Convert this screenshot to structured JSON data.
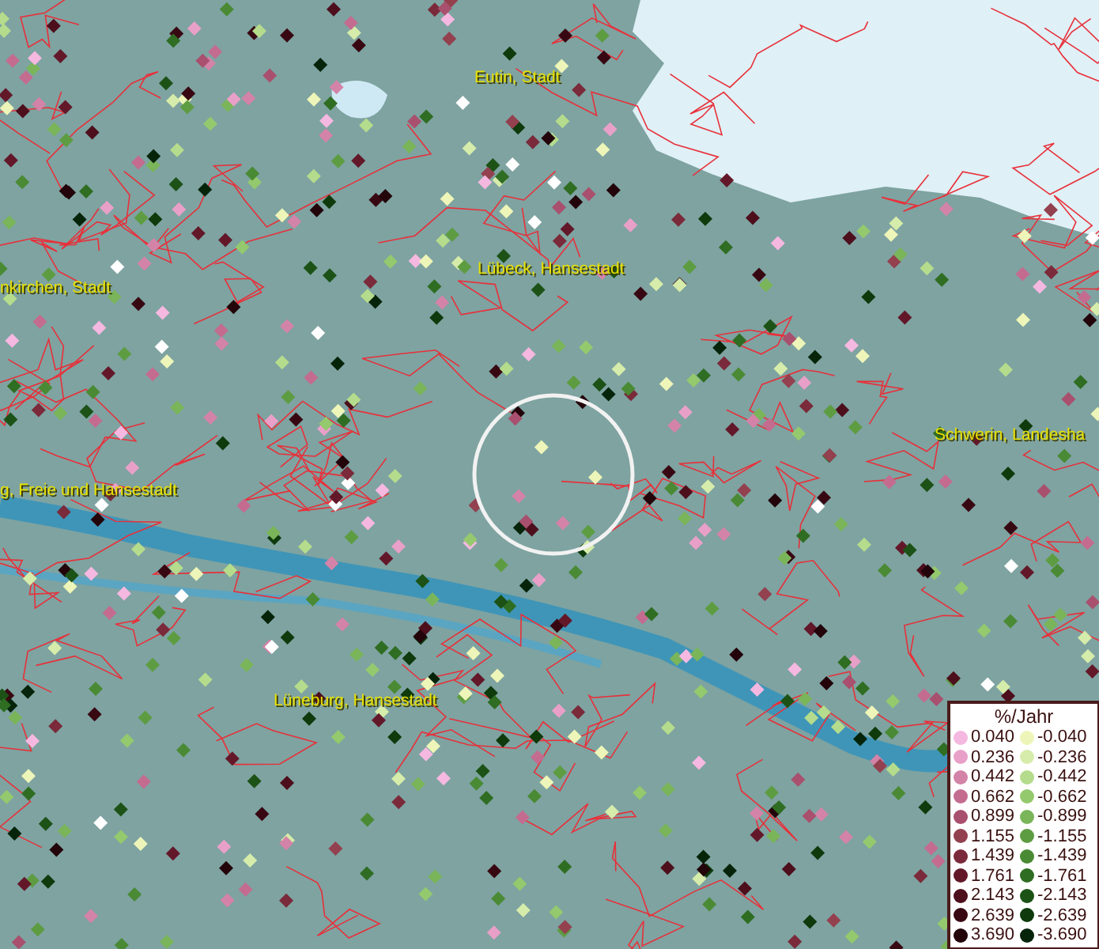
{
  "map": {
    "labels": [
      {
        "text": "Eutin, Stadt"
      },
      {
        "text": "Lübeck, Hansestadt"
      },
      {
        "text": "nkirchen, Stadt"
      },
      {
        "text": "Schwerin, Landesha"
      },
      {
        "text": "g, Freie und Hansestadt"
      },
      {
        "text": "Lüneburg, Hansestadt"
      }
    ]
  },
  "legend": {
    "title": "%/Jahr",
    "positive": [
      {
        "value": "0.040",
        "color": "#f5b8e0"
      },
      {
        "value": "0.236",
        "color": "#e8a0c8"
      },
      {
        "value": "0.442",
        "color": "#d483a8"
      },
      {
        "value": "0.662",
        "color": "#c46c90"
      },
      {
        "value": "0.899",
        "color": "#a8506e"
      },
      {
        "value": "1.155",
        "color": "#93404f"
      },
      {
        "value": "1.439",
        "color": "#7a2a3a"
      },
      {
        "value": "1.761",
        "color": "#63182a"
      },
      {
        "value": "2.143",
        "color": "#4d0f1c"
      },
      {
        "value": "2.639",
        "color": "#380812"
      },
      {
        "value": "3.690",
        "color": "#22040a"
      }
    ],
    "negative": [
      {
        "value": "-0.040",
        "color": "#eef5b8"
      },
      {
        "value": "-0.236",
        "color": "#d6ecaa"
      },
      {
        "value": "-0.442",
        "color": "#b5dc8c"
      },
      {
        "value": "-0.662",
        "color": "#94c96e"
      },
      {
        "value": "-0.899",
        "color": "#7ab55a"
      },
      {
        "value": "-1.155",
        "color": "#5e9c42"
      },
      {
        "value": "-1.439",
        "color": "#4a8a34"
      },
      {
        "value": "-1.761",
        "color": "#2f6d22"
      },
      {
        "value": "-2.143",
        "color": "#1c5216"
      },
      {
        "value": "-2.639",
        "color": "#0e3a0c"
      },
      {
        "value": "-3.690",
        "color": "#06240a"
      }
    ]
  }
}
